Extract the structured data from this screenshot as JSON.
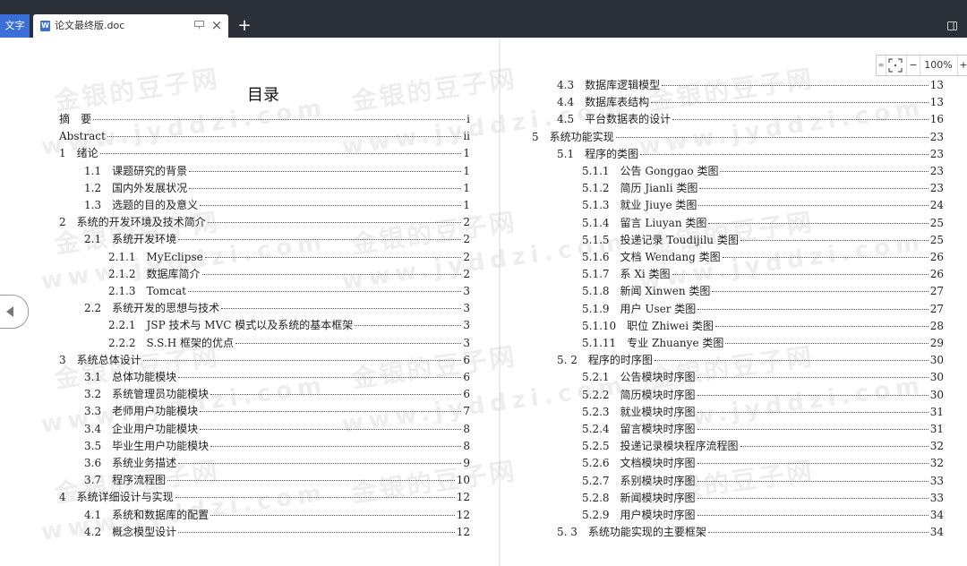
{
  "app": {
    "tab_label": "文字",
    "accent": "#3b6fd8"
  },
  "document_tab": {
    "title": "论文最终版.doc",
    "icon": "W"
  },
  "toolbar": {
    "add_tab": "+",
    "close": "×"
  },
  "zoom": {
    "level": "100%",
    "minus": "−",
    "plus": "+"
  },
  "watermark": {
    "cn": "金银的豆子网",
    "url": "www.jyddzi.com"
  },
  "toc": {
    "title": "目录",
    "left": [
      {
        "num": "摘　要",
        "text": "",
        "page": "i",
        "level": 0
      },
      {
        "num": "Abstract",
        "text": "",
        "page": "ii",
        "level": 0
      },
      {
        "num": "1",
        "text": "绪论",
        "page": "1",
        "level": 1
      },
      {
        "num": "1.1",
        "text": "课题研究的背景",
        "page": "1",
        "level": 2
      },
      {
        "num": "1.2",
        "text": "国内外发展状况",
        "page": "1",
        "level": 2
      },
      {
        "num": "1.3",
        "text": "选题的目的及意义",
        "page": "1",
        "level": 2
      },
      {
        "num": "2",
        "text": "系统的开发环境及技术简介",
        "page": "2",
        "level": 1
      },
      {
        "num": "2.1",
        "text": "系统开发环境",
        "page": "2",
        "level": 2
      },
      {
        "num": "2.1.1",
        "text": "MyEclipse",
        "page": "2",
        "level": 3
      },
      {
        "num": "2.1.2",
        "text": "数据库简介",
        "page": "2",
        "level": 3
      },
      {
        "num": "2.1.3",
        "text": "Tomcat",
        "page": "3",
        "level": 3
      },
      {
        "num": "2.2",
        "text": "系统开发的思想与技术",
        "page": "3",
        "level": 2
      },
      {
        "num": "2.2.1",
        "text": "JSP 技术与 MVC 模式以及系统的基本框架",
        "page": "3",
        "level": 3
      },
      {
        "num": "2.2.2",
        "text": "S.S.H 框架的优点",
        "page": "3",
        "level": 3
      },
      {
        "num": "3",
        "text": "系统总体设计",
        "page": "6",
        "level": 1
      },
      {
        "num": "3.1",
        "text": "总体功能模块",
        "page": "6",
        "level": 2
      },
      {
        "num": "3.2",
        "text": "系统管理员功能模块",
        "page": "6",
        "level": 2
      },
      {
        "num": "3.3",
        "text": "老师用户功能模块",
        "page": "7",
        "level": 2
      },
      {
        "num": "3.4",
        "text": "企业用户功能模块",
        "page": "8",
        "level": 2
      },
      {
        "num": "3.5",
        "text": "毕业生用户功能模块",
        "page": "8",
        "level": 2
      },
      {
        "num": "3.6",
        "text": "系统业务描述",
        "page": "9",
        "level": 2
      },
      {
        "num": "3.7",
        "text": "程序流程图",
        "page": "10",
        "level": 2
      },
      {
        "num": "4",
        "text": "系统详细设计与实现",
        "page": "12",
        "level": 1
      },
      {
        "num": "4.1",
        "text": "系统和数据库的配置",
        "page": "12",
        "level": 2
      },
      {
        "num": "4.2",
        "text": "概念模型设计",
        "page": "12",
        "level": 2
      }
    ],
    "right": [
      {
        "num": "4.3",
        "text": "数据库逻辑模型",
        "page": "13",
        "level": 2
      },
      {
        "num": "4.4",
        "text": "数据库表结构",
        "page": "13",
        "level": 2
      },
      {
        "num": "4.5",
        "text": "平台数据表的设计",
        "page": "16",
        "level": 2
      },
      {
        "num": "5",
        "text": "系统功能实现",
        "page": "23",
        "level": 1
      },
      {
        "num": "5.1",
        "text": "程序的类图",
        "page": "23",
        "level": 2
      },
      {
        "num": "5.1.1",
        "text": "公告 Gonggao 类图",
        "page": "23",
        "level": 3
      },
      {
        "num": "5.1.2",
        "text": "简历 Jianli 类图",
        "page": "23",
        "level": 3
      },
      {
        "num": "5.1.3",
        "text": "就业 Jiuye 类图",
        "page": "24",
        "level": 3
      },
      {
        "num": "5.1.4",
        "text": "留言 Liuyan 类图",
        "page": "25",
        "level": 3
      },
      {
        "num": "5.1.5",
        "text": "投递记录 Toudijilu 类图",
        "page": "25",
        "level": 3
      },
      {
        "num": "5.1.6",
        "text": "文档 Wendang 类图",
        "page": "26",
        "level": 3
      },
      {
        "num": "5.1.7",
        "text": "系 Xi 类图",
        "page": "26",
        "level": 3
      },
      {
        "num": "5.1.8",
        "text": "新闻 Xinwen 类图",
        "page": "27",
        "level": 3
      },
      {
        "num": "5.1.9",
        "text": "用户 User 类图",
        "page": "27",
        "level": 3
      },
      {
        "num": "5.1.10",
        "text": "职位 Zhiwei 类图",
        "page": "28",
        "level": 3
      },
      {
        "num": "5.1.11",
        "text": "专业 Zhuanye 类图",
        "page": "29",
        "level": 3
      },
      {
        "num": "5. 2",
        "text": "程序的时序图",
        "page": "30",
        "level": 2
      },
      {
        "num": "5.2.1",
        "text": "公告模块时序图",
        "page": "30",
        "level": 3
      },
      {
        "num": "5.2.2",
        "text": "简历模块时序图",
        "page": "30",
        "level": 3
      },
      {
        "num": "5.2.3",
        "text": "就业模块时序图",
        "page": "31",
        "level": 3
      },
      {
        "num": "5.2.4",
        "text": "留言模块时序图",
        "page": "31",
        "level": 3
      },
      {
        "num": "5.2.5",
        "text": "投递记录模块程序流程图",
        "page": "32",
        "level": 3
      },
      {
        "num": "5.2.6",
        "text": "文档模块时序图",
        "page": "32",
        "level": 3
      },
      {
        "num": "5.2.7",
        "text": "系别模块时序图",
        "page": "33",
        "level": 3
      },
      {
        "num": "5.2.8",
        "text": "新闻模块时序图",
        "page": "33",
        "level": 3
      },
      {
        "num": "5.2.9",
        "text": "用户模块时序图",
        "page": "34",
        "level": 3
      },
      {
        "num": "5. 3",
        "text": "系统功能实现的主要框架",
        "page": "34",
        "level": 2
      }
    ]
  }
}
